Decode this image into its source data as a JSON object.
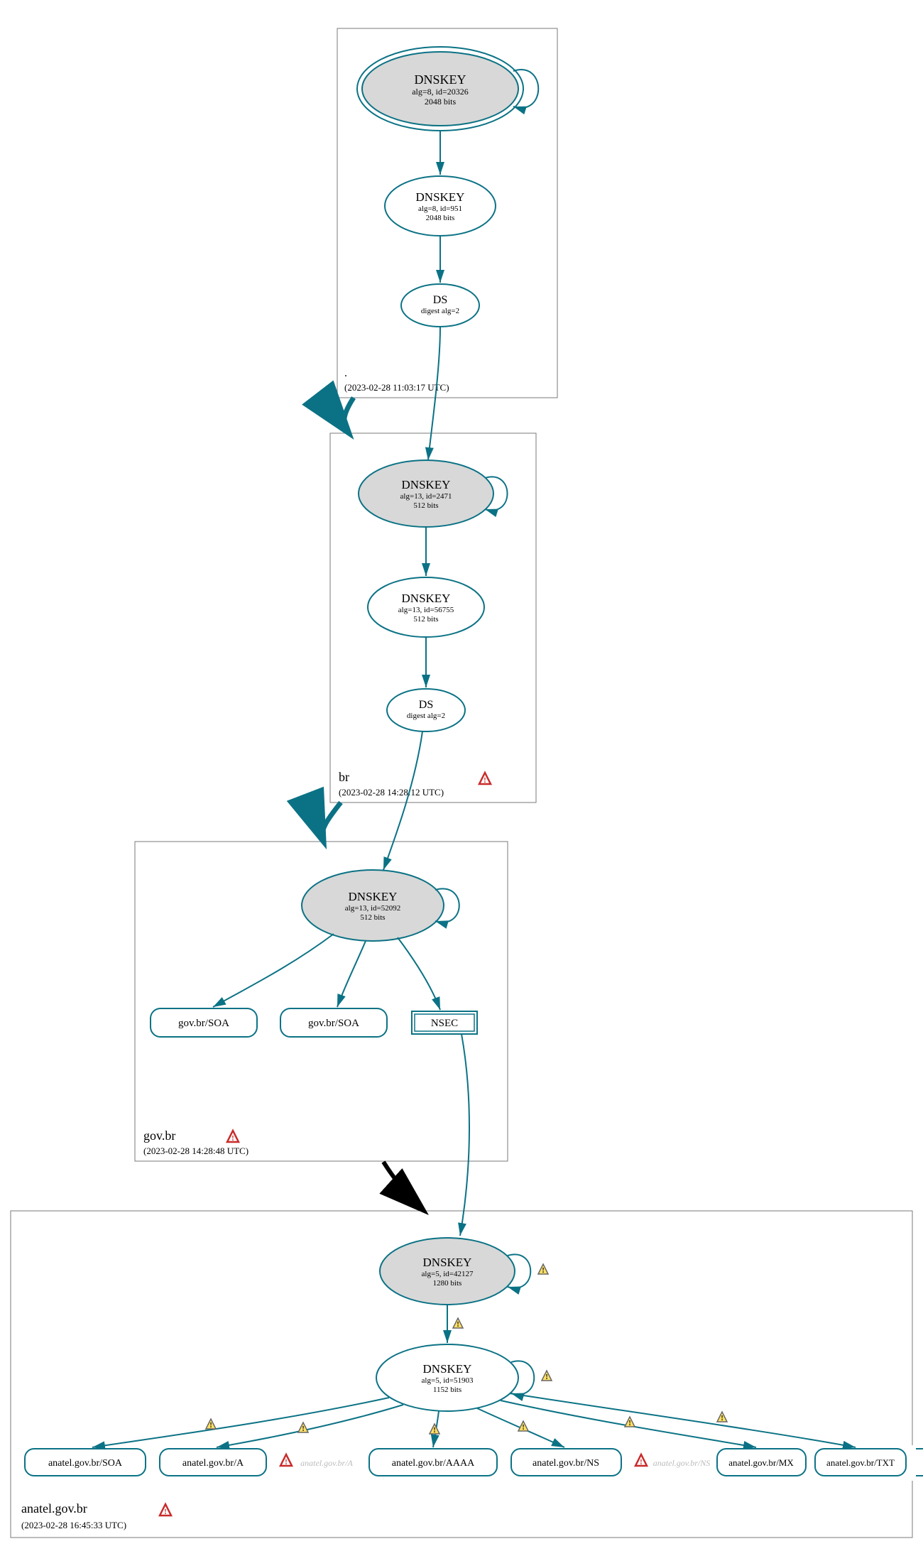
{
  "zones": {
    "root": {
      "name": ".",
      "timestamp": "(2023-02-28 11:03:17 UTC)",
      "warning": false
    },
    "br": {
      "name": "br",
      "timestamp": "(2023-02-28 14:28:12 UTC)",
      "warning": true
    },
    "govbr": {
      "name": "gov.br",
      "timestamp": "(2023-02-28 14:28:48 UTC)",
      "warning": true
    },
    "anatel": {
      "name": "anatel.gov.br",
      "timestamp": "(2023-02-28 16:45:33 UTC)",
      "warning": true
    }
  },
  "nodes": {
    "root_ksk": {
      "title": "DNSKEY",
      "sub1": "alg=8, id=20326",
      "sub2": "2048 bits"
    },
    "root_zsk": {
      "title": "DNSKEY",
      "sub1": "alg=8, id=951",
      "sub2": "2048 bits"
    },
    "root_ds": {
      "title": "DS",
      "sub1": "digest alg=2"
    },
    "br_ksk": {
      "title": "DNSKEY",
      "sub1": "alg=13, id=2471",
      "sub2": "512 bits"
    },
    "br_zsk": {
      "title": "DNSKEY",
      "sub1": "alg=13, id=56755",
      "sub2": "512 bits"
    },
    "br_ds": {
      "title": "DS",
      "sub1": "digest alg=2"
    },
    "govbr_ksk": {
      "title": "DNSKEY",
      "sub1": "alg=13, id=52092",
      "sub2": "512 bits"
    },
    "govbr_soa1": {
      "title": "gov.br/SOA"
    },
    "govbr_soa2": {
      "title": "gov.br/SOA"
    },
    "govbr_nsec": {
      "title": "NSEC"
    },
    "anatel_ksk": {
      "title": "DNSKEY",
      "sub1": "alg=5, id=42127",
      "sub2": "1280 bits"
    },
    "anatel_zsk": {
      "title": "DNSKEY",
      "sub1": "alg=5, id=51903",
      "sub2": "1152 bits"
    },
    "anatel_soa": {
      "title": "anatel.gov.br/SOA"
    },
    "anatel_a": {
      "title": "anatel.gov.br/A"
    },
    "anatel_a_grey": {
      "title": "anatel.gov.br/A"
    },
    "anatel_aaaa": {
      "title": "anatel.gov.br/AAAA"
    },
    "anatel_ns": {
      "title": "anatel.gov.br/NS"
    },
    "anatel_ns_grey": {
      "title": "anatel.gov.br/NS"
    },
    "anatel_mx": {
      "title": "anatel.gov.br/MX"
    },
    "anatel_txt": {
      "title": "anatel.gov.br/TXT"
    }
  },
  "colors": {
    "teal": "#0b7285",
    "grey_fill": "#d8d8d8",
    "box": "#7a7a7a",
    "black": "#000000",
    "warn_red": "#c92a2a",
    "warn_yellow": "#ffe066",
    "warn_yellow_stroke": "#666",
    "grey_text": "#bbb"
  }
}
